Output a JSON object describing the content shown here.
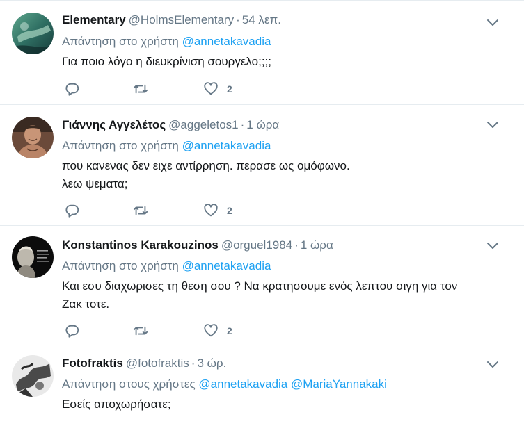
{
  "tweets": [
    {
      "fullname": "Elementary",
      "username": "@HolmsElementary",
      "dot": "·",
      "time": "54 λεπ.",
      "reply_prefix": "Απάντηση στο χρήστη",
      "mentions": [
        "@annetakavadia"
      ],
      "text_lines": [
        "Για ποιο λόγο η διευκρίνιση σουργελο;;;;"
      ],
      "like_count": "2",
      "avatar_icon": "underwater-photo-avatar"
    },
    {
      "fullname": "Γιάννης Αγγελέτος",
      "username": "@aggeletos1",
      "dot": "·",
      "time": "1 ώρα",
      "reply_prefix": "Απάντηση στο χρήστη",
      "mentions": [
        "@annetakavadia"
      ],
      "text_lines": [
        "που κανενας δεν ειχε αντίρρηση. περασε ως ομόφωνο.",
        "λεω ψεματα;"
      ],
      "like_count": "2",
      "avatar_icon": "man-portrait-avatar"
    },
    {
      "fullname": "Konstantinos Karakouzinos",
      "username": "@orguel1984",
      "dot": "·",
      "time": "1 ώρα",
      "reply_prefix": "Απάντηση στο χρήστη",
      "mentions": [
        "@annetakavadia"
      ],
      "text_lines": [
        "Και εσυ διαχωρισες τη θεση σου ? Να κρατησουμε ενός λεπτου σιγη για τον",
        "Ζακ τοτε."
      ],
      "like_count": "2",
      "avatar_icon": "bust-quote-avatar"
    },
    {
      "fullname": "Fotofraktis",
      "username": "@fotofraktis",
      "dot": "·",
      "time": "3 ώρ.",
      "reply_prefix": "Απάντηση στους χρήστες",
      "mentions": [
        "@annetakavadia",
        "@MariaYannakaki"
      ],
      "text_lines": [
        "Εσείς αποχωρήσατε;"
      ],
      "like_count": "",
      "avatar_icon": "monochrome-photo-avatar"
    }
  ],
  "colors": {
    "name": "#14171a",
    "secondary": "#657786",
    "link": "#1da1f2",
    "divider": "#e6ecf0"
  },
  "icons": {
    "reply": "reply-icon",
    "retweet": "retweet-icon",
    "like": "heart-icon",
    "menu": "chevron-down-icon"
  }
}
